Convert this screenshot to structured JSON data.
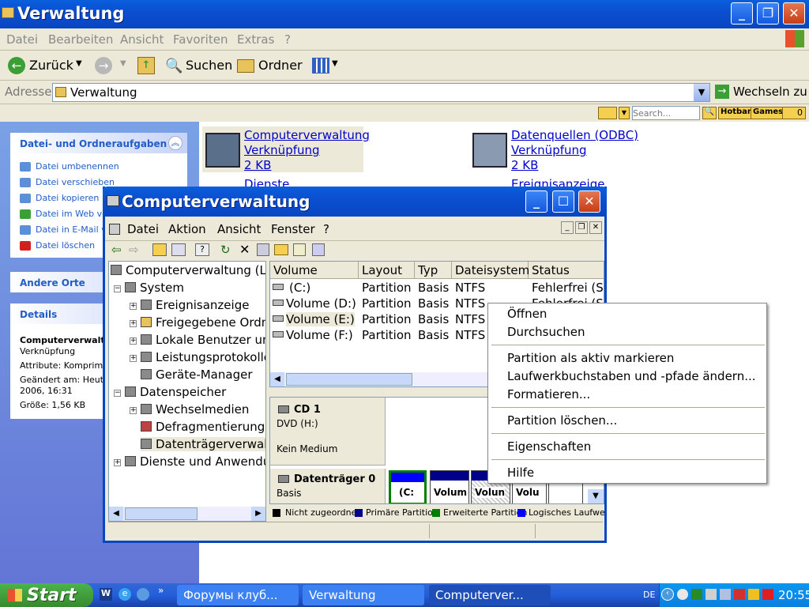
{
  "explorer": {
    "title": "Verwaltung",
    "menu": [
      "Datei",
      "Bearbeiten",
      "Ansicht",
      "Favoriten",
      "Extras",
      "?"
    ],
    "toolbar": {
      "back": "Zurück",
      "search": "Suchen",
      "folders": "Ordner"
    },
    "address": {
      "label": "Adresse",
      "value": "Verwaltung",
      "go": "Wechseln zu"
    },
    "linkbar": {
      "search_placeholder": "Search...",
      "hotbar": "Hotbar",
      "games": "Games",
      "count": "0"
    },
    "tasks_panel": {
      "title": "Datei- und Ordneraufgaben",
      "items": [
        "Datei umbenennen",
        "Datei verschieben",
        "Datei kopieren",
        "Datei im Web veröffentlichen",
        "Datei in E-Mail versenden",
        "Datei löschen"
      ]
    },
    "other_panel": {
      "title": "Andere Orte"
    },
    "details_panel": {
      "title": "Details",
      "name": "Computerverwaltung",
      "type": "Verknüpfung",
      "attr": "Attribute: Komprimiert",
      "changed1": "Geändert am: Heute,",
      "changed2": "2006, 16:31",
      "size": "Größe: 1,56 KB"
    },
    "files": [
      {
        "name": "Computerverwaltung",
        "type": "Verknüpfung",
        "size": "2 KB"
      },
      {
        "name": "Datenquellen (ODBC)",
        "type": "Verknüpfung",
        "size": "2 KB"
      },
      {
        "name": "Dienste"
      },
      {
        "name": "Ereignisanzeige"
      }
    ]
  },
  "mmc": {
    "title": "Computerverwaltung",
    "menu": [
      "Datei",
      "Aktion",
      "Ansicht",
      "Fenster",
      "?"
    ],
    "tree": [
      {
        "label": "Computerverwaltung (Lokal)"
      },
      {
        "label": "System"
      },
      {
        "label": "Ereignisanzeige"
      },
      {
        "label": "Freigegebene Ordner"
      },
      {
        "label": "Lokale Benutzer und Gruppen"
      },
      {
        "label": "Leistungsprotokolle und Warnungen"
      },
      {
        "label": "Geräte-Manager"
      },
      {
        "label": "Datenspeicher"
      },
      {
        "label": "Wechselmedien"
      },
      {
        "label": "Defragmentierung"
      },
      {
        "label": "Datenträgerverwaltung"
      },
      {
        "label": "Dienste und Anwendungen"
      }
    ],
    "columns": [
      "Volume",
      "Layout",
      "Typ",
      "Dateisystem",
      "Status"
    ],
    "rows": [
      [
        "(C:)",
        "Partition",
        "Basis",
        "NTFS",
        "Fehlerfrei (St"
      ],
      [
        "Volume (D:)",
        "Partition",
        "Basis",
        "NTFS",
        "Fehlerfrei (S"
      ],
      [
        "Volume (E:)",
        "Partition",
        "Basis",
        "NTFS",
        ""
      ],
      [
        "Volume (F:)",
        "Partition",
        "Basis",
        "NTFS",
        ""
      ]
    ],
    "disks": [
      {
        "name": "CD 1",
        "line2": "DVD (H:)",
        "line3": "Kein Medium"
      },
      {
        "name": "Datenträger 0",
        "line2": "Basis"
      }
    ],
    "partitions": [
      "(C:",
      "Volum",
      "Volun",
      "Volu"
    ],
    "legend": [
      "Nicht zugeordnet",
      "Primäre Partition",
      "Erweiterte Partition",
      "Logisches Laufwerk"
    ],
    "colors": {
      "unalloc": "#000000",
      "primary": "#00008b",
      "extended": "#008000",
      "logical": "#0000ff"
    }
  },
  "context_menu": {
    "items": [
      "Öffnen",
      "Durchsuchen",
      "Partition als aktiv markieren",
      "Laufwerkbuchstaben und -pfade ändern...",
      "Formatieren...",
      "Partition löschen...",
      "Eigenschaften",
      "Hilfe"
    ]
  },
  "taskbar": {
    "start": "Start",
    "tasks": [
      "Форумы клуб...",
      "Verwaltung",
      "Computerver..."
    ],
    "lang": "DE",
    "clock": "20:55"
  }
}
